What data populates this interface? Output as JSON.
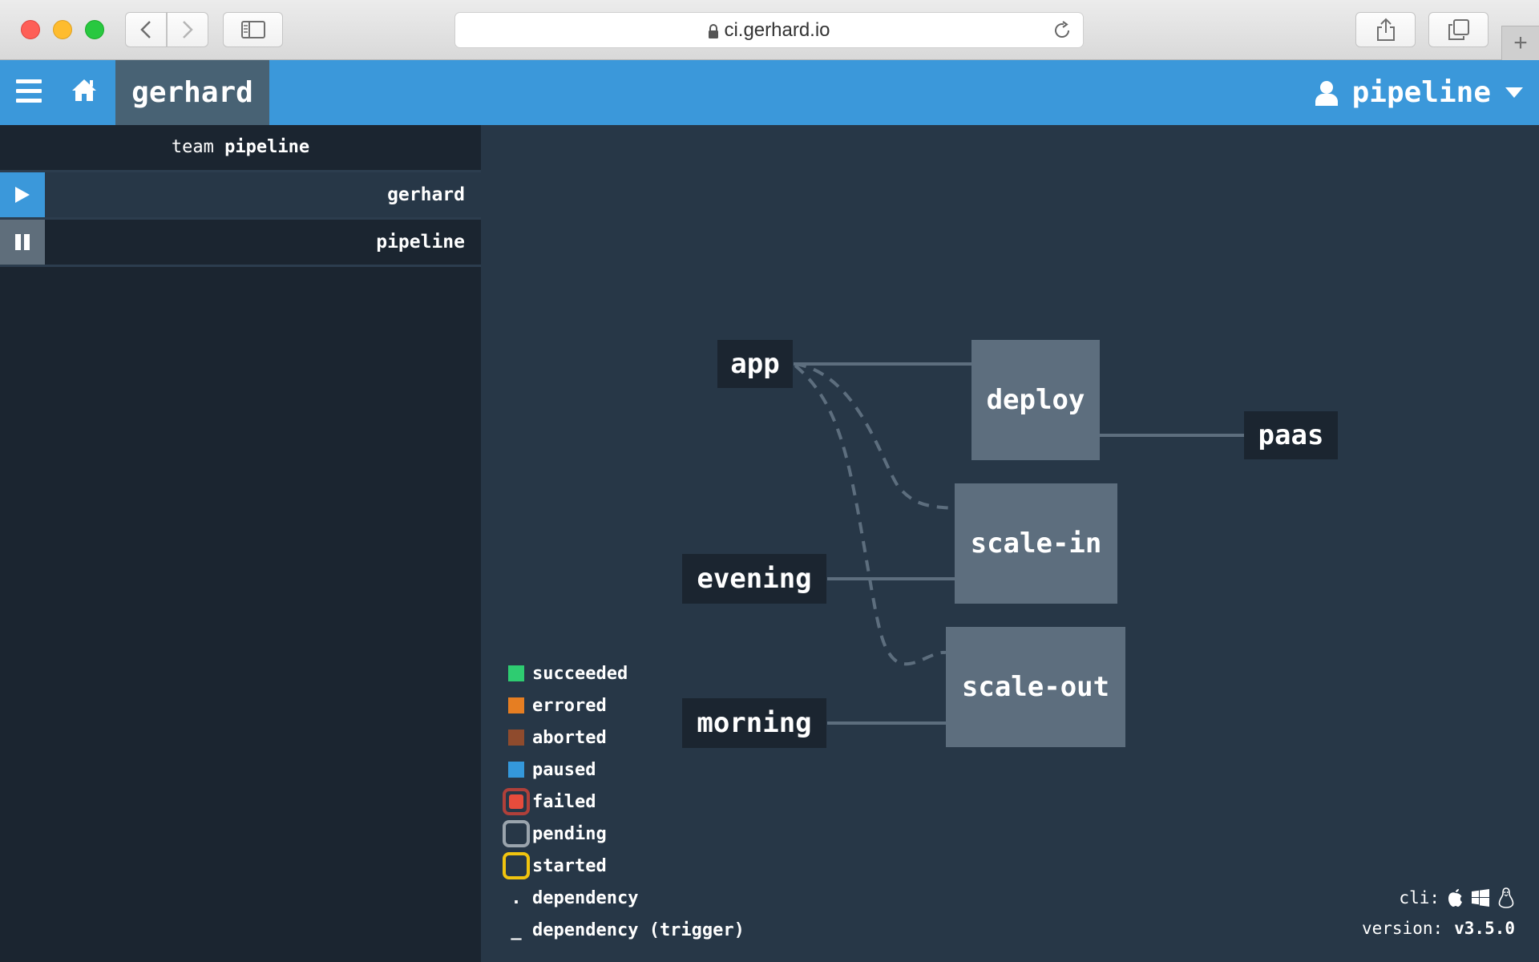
{
  "browser": {
    "url": "ci.gerhard.io",
    "icons": [
      "back-icon",
      "forward-icon",
      "sidebar-icon",
      "lock-icon",
      "reload-icon",
      "share-icon",
      "tabs-icon",
      "plus-icon"
    ]
  },
  "topbar": {
    "breadcrumb": "gerhard",
    "user": "pipeline",
    "color": "#3b98da"
  },
  "sidebar": {
    "team_prefix": "team",
    "team_name": "pipeline",
    "pipelines": [
      {
        "name": "gerhard",
        "state": "paused",
        "control": "play-icon"
      },
      {
        "name": "pipeline",
        "state": "active",
        "control": "pause-icon"
      }
    ]
  },
  "graph": {
    "resources": [
      "app",
      "evening",
      "morning",
      "paas"
    ],
    "jobs": [
      "deploy",
      "scale-in",
      "scale-out"
    ],
    "job_color": "#5d6e7e",
    "edges": [
      {
        "from": "app",
        "to": "deploy",
        "type": "trigger"
      },
      {
        "from": "app",
        "to": "scale-in",
        "type": "dependency"
      },
      {
        "from": "app",
        "to": "scale-out",
        "type": "dependency"
      },
      {
        "from": "evening",
        "to": "scale-in",
        "type": "trigger"
      },
      {
        "from": "morning",
        "to": "scale-out",
        "type": "trigger"
      },
      {
        "from": "deploy",
        "to": "paas",
        "type": "trigger"
      }
    ]
  },
  "legend": [
    {
      "label": "succeeded",
      "color": "#2ecc71"
    },
    {
      "label": "errored",
      "color": "#e67e22"
    },
    {
      "label": "aborted",
      "color": "#8f4b2d"
    },
    {
      "label": "paused",
      "color": "#3498db"
    },
    {
      "label": "failed",
      "color": "#e74c3c"
    },
    {
      "label": "pending",
      "color": "#9aa4ad"
    },
    {
      "label": "started",
      "color": "#f1c40f"
    },
    {
      "label": "dependency",
      "symbol": "."
    },
    {
      "label": "dependency (trigger)",
      "symbol": "_"
    }
  ],
  "footer": {
    "cli_label": "cli:",
    "cli_icons": [
      "apple-icon",
      "windows-icon",
      "linux-icon"
    ],
    "version_label": "version:",
    "version": "v3.5.0"
  }
}
